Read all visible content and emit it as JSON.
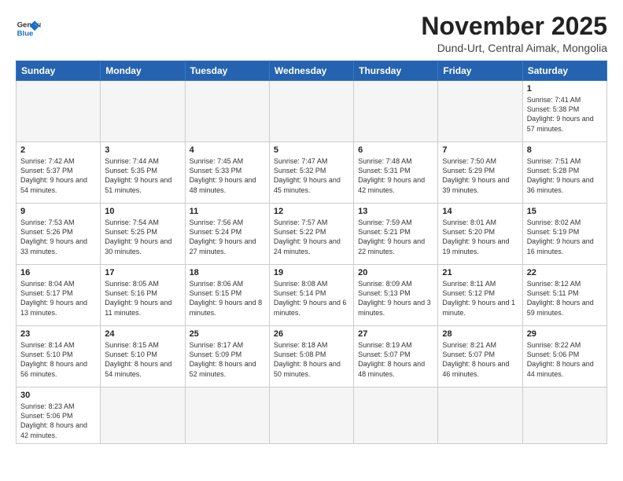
{
  "header": {
    "logo_general": "General",
    "logo_blue": "Blue",
    "month_title": "November 2025",
    "subtitle": "Dund-Urt, Central Aimak, Mongolia"
  },
  "weekdays": [
    "Sunday",
    "Monday",
    "Tuesday",
    "Wednesday",
    "Thursday",
    "Friday",
    "Saturday"
  ],
  "weeks": [
    [
      {
        "day": "",
        "empty": true
      },
      {
        "day": "",
        "empty": true
      },
      {
        "day": "",
        "empty": true
      },
      {
        "day": "",
        "empty": true
      },
      {
        "day": "",
        "empty": true
      },
      {
        "day": "",
        "empty": true
      },
      {
        "day": "1",
        "sunrise": "Sunrise: 7:41 AM",
        "sunset": "Sunset: 5:38 PM",
        "daylight": "Daylight: 9 hours and 57 minutes."
      }
    ],
    [
      {
        "day": "2",
        "sunrise": "Sunrise: 7:42 AM",
        "sunset": "Sunset: 5:37 PM",
        "daylight": "Daylight: 9 hours and 54 minutes."
      },
      {
        "day": "3",
        "sunrise": "Sunrise: 7:44 AM",
        "sunset": "Sunset: 5:35 PM",
        "daylight": "Daylight: 9 hours and 51 minutes."
      },
      {
        "day": "4",
        "sunrise": "Sunrise: 7:45 AM",
        "sunset": "Sunset: 5:33 PM",
        "daylight": "Daylight: 9 hours and 48 minutes."
      },
      {
        "day": "5",
        "sunrise": "Sunrise: 7:47 AM",
        "sunset": "Sunset: 5:32 PM",
        "daylight": "Daylight: 9 hours and 45 minutes."
      },
      {
        "day": "6",
        "sunrise": "Sunrise: 7:48 AM",
        "sunset": "Sunset: 5:31 PM",
        "daylight": "Daylight: 9 hours and 42 minutes."
      },
      {
        "day": "7",
        "sunrise": "Sunrise: 7:50 AM",
        "sunset": "Sunset: 5:29 PM",
        "daylight": "Daylight: 9 hours and 39 minutes."
      },
      {
        "day": "8",
        "sunrise": "Sunrise: 7:51 AM",
        "sunset": "Sunset: 5:28 PM",
        "daylight": "Daylight: 9 hours and 36 minutes."
      }
    ],
    [
      {
        "day": "9",
        "sunrise": "Sunrise: 7:53 AM",
        "sunset": "Sunset: 5:26 PM",
        "daylight": "Daylight: 9 hours and 33 minutes."
      },
      {
        "day": "10",
        "sunrise": "Sunrise: 7:54 AM",
        "sunset": "Sunset: 5:25 PM",
        "daylight": "Daylight: 9 hours and 30 minutes."
      },
      {
        "day": "11",
        "sunrise": "Sunrise: 7:56 AM",
        "sunset": "Sunset: 5:24 PM",
        "daylight": "Daylight: 9 hours and 27 minutes."
      },
      {
        "day": "12",
        "sunrise": "Sunrise: 7:57 AM",
        "sunset": "Sunset: 5:22 PM",
        "daylight": "Daylight: 9 hours and 24 minutes."
      },
      {
        "day": "13",
        "sunrise": "Sunrise: 7:59 AM",
        "sunset": "Sunset: 5:21 PM",
        "daylight": "Daylight: 9 hours and 22 minutes."
      },
      {
        "day": "14",
        "sunrise": "Sunrise: 8:01 AM",
        "sunset": "Sunset: 5:20 PM",
        "daylight": "Daylight: 9 hours and 19 minutes."
      },
      {
        "day": "15",
        "sunrise": "Sunrise: 8:02 AM",
        "sunset": "Sunset: 5:19 PM",
        "daylight": "Daylight: 9 hours and 16 minutes."
      }
    ],
    [
      {
        "day": "16",
        "sunrise": "Sunrise: 8:04 AM",
        "sunset": "Sunset: 5:17 PM",
        "daylight": "Daylight: 9 hours and 13 minutes."
      },
      {
        "day": "17",
        "sunrise": "Sunrise: 8:05 AM",
        "sunset": "Sunset: 5:16 PM",
        "daylight": "Daylight: 9 hours and 11 minutes."
      },
      {
        "day": "18",
        "sunrise": "Sunrise: 8:06 AM",
        "sunset": "Sunset: 5:15 PM",
        "daylight": "Daylight: 9 hours and 8 minutes."
      },
      {
        "day": "19",
        "sunrise": "Sunrise: 8:08 AM",
        "sunset": "Sunset: 5:14 PM",
        "daylight": "Daylight: 9 hours and 6 minutes."
      },
      {
        "day": "20",
        "sunrise": "Sunrise: 8:09 AM",
        "sunset": "Sunset: 5:13 PM",
        "daylight": "Daylight: 9 hours and 3 minutes."
      },
      {
        "day": "21",
        "sunrise": "Sunrise: 8:11 AM",
        "sunset": "Sunset: 5:12 PM",
        "daylight": "Daylight: 9 hours and 1 minute."
      },
      {
        "day": "22",
        "sunrise": "Sunrise: 8:12 AM",
        "sunset": "Sunset: 5:11 PM",
        "daylight": "Daylight: 8 hours and 59 minutes."
      }
    ],
    [
      {
        "day": "23",
        "sunrise": "Sunrise: 8:14 AM",
        "sunset": "Sunset: 5:10 PM",
        "daylight": "Daylight: 8 hours and 56 minutes."
      },
      {
        "day": "24",
        "sunrise": "Sunrise: 8:15 AM",
        "sunset": "Sunset: 5:10 PM",
        "daylight": "Daylight: 8 hours and 54 minutes."
      },
      {
        "day": "25",
        "sunrise": "Sunrise: 8:17 AM",
        "sunset": "Sunset: 5:09 PM",
        "daylight": "Daylight: 8 hours and 52 minutes."
      },
      {
        "day": "26",
        "sunrise": "Sunrise: 8:18 AM",
        "sunset": "Sunset: 5:08 PM",
        "daylight": "Daylight: 8 hours and 50 minutes."
      },
      {
        "day": "27",
        "sunrise": "Sunrise: 8:19 AM",
        "sunset": "Sunset: 5:07 PM",
        "daylight": "Daylight: 8 hours and 48 minutes."
      },
      {
        "day": "28",
        "sunrise": "Sunrise: 8:21 AM",
        "sunset": "Sunset: 5:07 PM",
        "daylight": "Daylight: 8 hours and 46 minutes."
      },
      {
        "day": "29",
        "sunrise": "Sunrise: 8:22 AM",
        "sunset": "Sunset: 5:06 PM",
        "daylight": "Daylight: 8 hours and 44 minutes."
      }
    ],
    [
      {
        "day": "30",
        "sunrise": "Sunrise: 8:23 AM",
        "sunset": "Sunset: 5:06 PM",
        "daylight": "Daylight: 8 hours and 42 minutes."
      },
      {
        "day": "",
        "empty": true
      },
      {
        "day": "",
        "empty": true
      },
      {
        "day": "",
        "empty": true
      },
      {
        "day": "",
        "empty": true
      },
      {
        "day": "",
        "empty": true
      },
      {
        "day": "",
        "empty": true
      }
    ]
  ]
}
